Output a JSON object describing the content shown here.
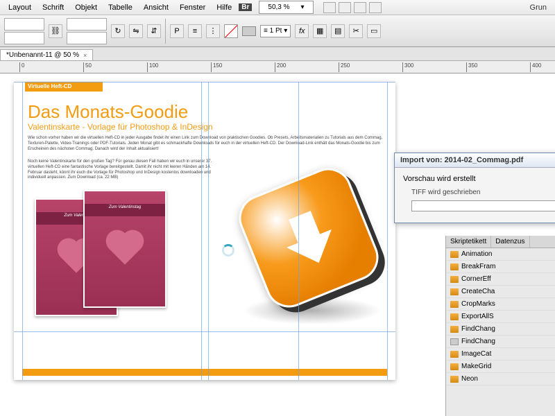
{
  "menu": {
    "items": [
      "Layout",
      "Schrift",
      "Objekt",
      "Tabelle",
      "Ansicht",
      "Fenster",
      "Hilfe"
    ],
    "zoom": "50,3 %",
    "right": "Grun"
  },
  "toolbar": {
    "pt": "1 Pt"
  },
  "doctab": {
    "label": "*Unbenannt-11 @ 50 %"
  },
  "ruler": {
    "marks": [
      0,
      50,
      100,
      150,
      200,
      250,
      300,
      350,
      400
    ]
  },
  "page": {
    "banner": "Virtuelle Heft-CD",
    "headline": "Das Monats-Goodie",
    "subhead": "Valentinskarte - Vorlage für Photoshop & InDesign",
    "body1": "Wie schon vorher haben wir die virtuellen Heft-CD in jeder Ausgabe findet ihr einen Link zum Download von praktischen Goodies. Ob Presets, Arbeitsmaterialien zu Tutorials aus dem Commag, Texturen-Palette, Video-Trainings oder PDF-Tutorials. Jeden Monat gibt es schmackhafte Downloads für euch in der virtuellen Heft-CD. Der Download-Link enthält das Monats-Goodie bis zum Erscheinen des nächsten Commag. Danach wird der Inhalt aktualisiert!",
    "body2": "Noch keine Valentinskarte für den großen Tag? Für genau diesen Fall haben wir euch in unserer 37. virtuellen Heft-CD eine fantastische Vorlage bereitgestellt. Damit ihr nicht mit leeren Händen am 14. Februar dasteht, könnt ihr euch die Vorlage für Photoshop und InDesign kostenlos downloaden und individuell anpassen. Zum Download (ca. 22 MB)",
    "ribbon1": "Zum Valentin",
    "ribbon2": "Zum Valentinstag"
  },
  "dialog": {
    "title": "Import von: 2014-02_Commag.pdf",
    "line1": "Vorschau wird erstellt",
    "line2": "TIFF wird geschrieben"
  },
  "panel": {
    "tabs": [
      "Skriptetikett",
      "Datenzus"
    ],
    "items": [
      "Animation",
      "BreakFram",
      "CornerEff",
      "CreateCha",
      "CropMarks",
      "ExportAllS",
      "FindChang",
      "FindChang",
      "ImageCat",
      "MakeGrid",
      "Neon"
    ]
  }
}
